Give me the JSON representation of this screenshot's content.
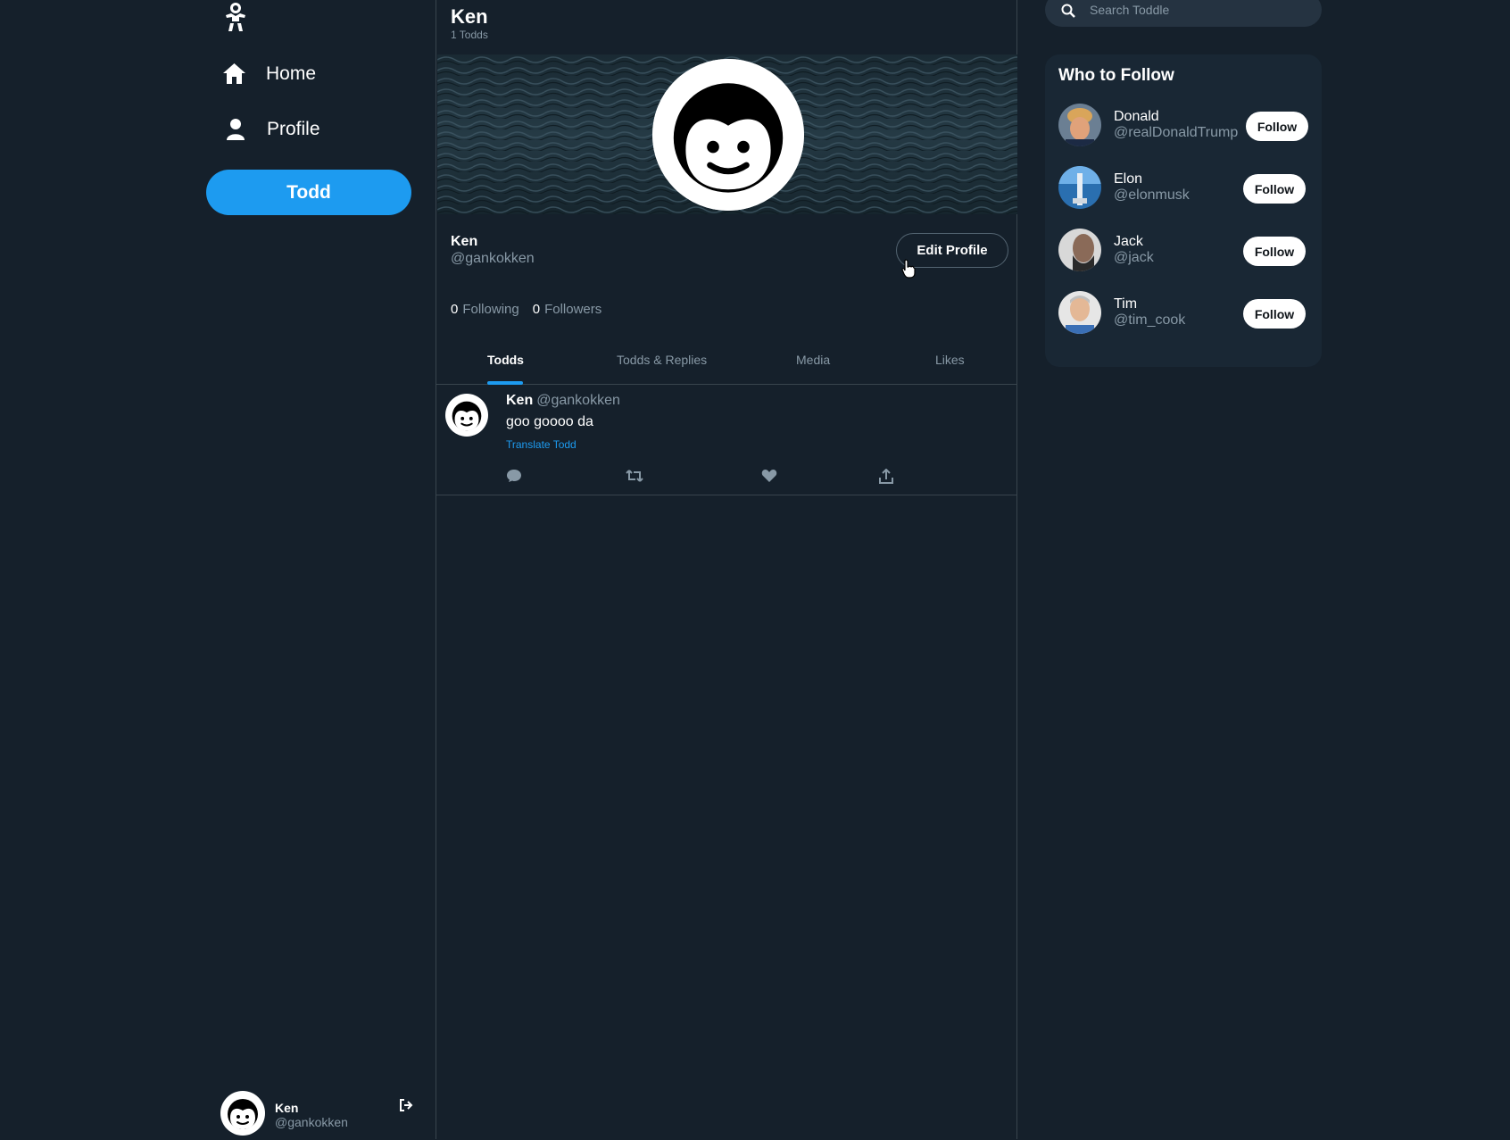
{
  "app": {
    "name": "Toddle",
    "accent": "#1d9bf0",
    "background": "#15202b"
  },
  "sidebar": {
    "logo_icon": "baby-logo-icon",
    "items": [
      {
        "label": "Home",
        "icon": "home-icon"
      },
      {
        "label": "Profile",
        "icon": "user-icon"
      }
    ],
    "post_button_label": "Todd",
    "account": {
      "name": "Ken",
      "handle": "@gankokken",
      "logout_icon": "logout-icon"
    }
  },
  "profile": {
    "header_title": "Ken",
    "header_subtitle": "1 Todds",
    "name": "Ken",
    "handle": "@gankokken",
    "edit_button_label": "Edit Profile",
    "following_count": "0",
    "following_label": "Following",
    "followers_count": "0",
    "followers_label": "Followers",
    "tabs": [
      {
        "label": "Todds",
        "active": true
      },
      {
        "label": "Todds & Replies",
        "active": false
      },
      {
        "label": "Media",
        "active": false
      },
      {
        "label": "Likes",
        "active": false
      }
    ]
  },
  "posts": [
    {
      "name": "Ken",
      "handle": "@gankokken",
      "text": "goo goooo da",
      "translate_label": "Translate Todd",
      "actions": [
        "comment-icon",
        "retweet-icon",
        "heart-icon",
        "share-icon"
      ]
    }
  ],
  "search": {
    "placeholder": "Search Toddle",
    "icon": "search-icon"
  },
  "who_to_follow": {
    "title": "Who to Follow",
    "users": [
      {
        "name": "Donald",
        "handle": "@realDonaldTrump",
        "button": "Follow"
      },
      {
        "name": "Elon",
        "handle": "@elonmusk",
        "button": "Follow"
      },
      {
        "name": "Jack",
        "handle": "@jack",
        "button": "Follow"
      },
      {
        "name": "Tim",
        "handle": "@tim_cook",
        "button": "Follow"
      }
    ]
  }
}
